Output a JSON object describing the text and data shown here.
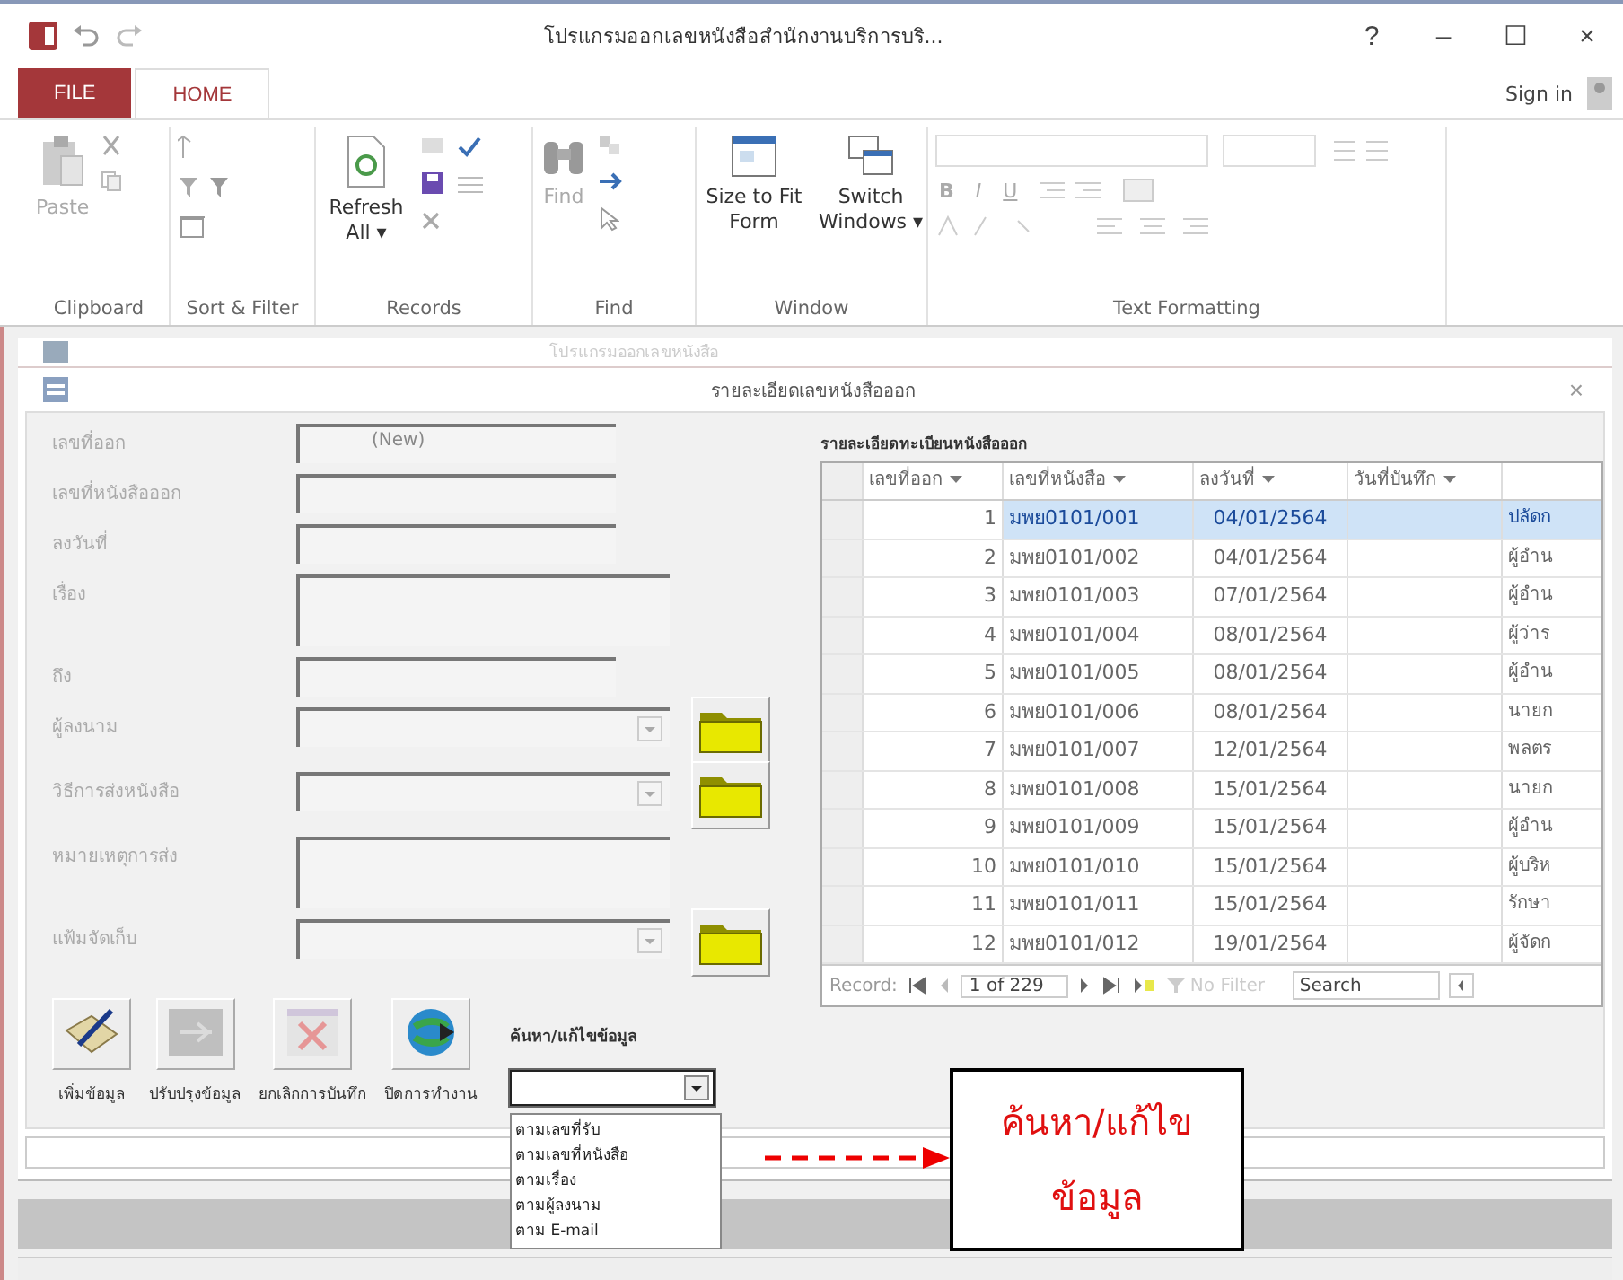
{
  "window": {
    "title": "โปรแกรมออกเลขหนังสือสำนักงานบริการบริ...",
    "help": "?",
    "minimize": "–",
    "maximize": "☐",
    "close": "×"
  },
  "ribbon": {
    "tabs": [
      {
        "label": "FILE",
        "kind": "file",
        "selected": false
      },
      {
        "label": "HOME",
        "kind": "tab",
        "selected": true
      }
    ],
    "sign_in": "Sign in",
    "groups": [
      {
        "label": "Clipboard",
        "buttons": [
          "Paste"
        ]
      },
      {
        "label": "Sort & Filter"
      },
      {
        "label": "Records",
        "buttons": [
          "Refresh All ▾"
        ]
      },
      {
        "label": "Find",
        "buttons": [
          "Find"
        ]
      },
      {
        "label": "Window",
        "buttons": [
          "Size to Fit Form",
          "Switch Windows ▾"
        ]
      },
      {
        "label": "Text Formatting",
        "buttons": [
          "B",
          "I",
          "U"
        ]
      }
    ]
  },
  "background_window": {
    "title": "โปรแกรมออกเลขหนังสือ"
  },
  "form": {
    "title": "รายละเอียดเลขหนังสือออก",
    "close": "×",
    "fields": [
      {
        "label": "เลขที่ออก",
        "kind": "text",
        "value": "(New)"
      },
      {
        "label": "เลขที่หนังสือออก",
        "kind": "text"
      },
      {
        "label": "ลงวันที่",
        "kind": "text"
      },
      {
        "label": "เรื่อง",
        "kind": "memo"
      },
      {
        "label": "ถึง",
        "kind": "text"
      },
      {
        "label": "ผู้ลงนาม",
        "kind": "combo"
      },
      {
        "label": "วิธีการส่งหนังสือ",
        "kind": "combo"
      },
      {
        "label": "หมายเหตุการส่ง",
        "kind": "memo"
      },
      {
        "label": "แฟ้มจัดเก็บ",
        "kind": "combo"
      }
    ],
    "buttons": [
      {
        "label": "เพิ่มข้อมูล",
        "kind": "add",
        "disabled": false
      },
      {
        "label": "ปรับปรุงข้อมูล",
        "kind": "update",
        "disabled": true
      },
      {
        "label": "ยกเลิกการบันทึก",
        "kind": "cancel",
        "disabled": true
      },
      {
        "label": "ปิดการทำงาน",
        "kind": "close",
        "disabled": false
      }
    ],
    "search": {
      "label": "ค้นหา/แก้ไขข้อมูล",
      "expanded": true,
      "options": [
        "ตามเลขที่รับ",
        "ตามเลขที่หนังสือ",
        "ตามเรื่อง",
        "ตามผู้ลงนาม",
        "ตาม E-mail"
      ]
    }
  },
  "table": {
    "title": "รายละเอียดทะเบียนหนังสือออก",
    "columns": [
      "เลขที่ออก",
      "เลขที่หนังสือ",
      "ลงวันที่",
      "วันที่บันทึก"
    ],
    "rows": [
      {
        "number": "1",
        "doc": "มพย0101/001",
        "date": "04/01/2564",
        "column_5": "ปลัดก",
        "selected": true
      },
      {
        "number": "2",
        "doc": "มพย0101/002",
        "date": "04/01/2564",
        "column_5": "ผู้อำน",
        "selected": false
      },
      {
        "number": "3",
        "doc": "มพย0101/003",
        "date": "07/01/2564",
        "column_5": "ผู้อำน",
        "selected": false
      },
      {
        "number": "4",
        "doc": "มพย0101/004",
        "date": "08/01/2564",
        "column_5": "ผู้ว่าร",
        "selected": false
      },
      {
        "number": "5",
        "doc": "มพย0101/005",
        "date": "08/01/2564",
        "column_5": "ผู้อำน",
        "selected": false
      },
      {
        "number": "6",
        "doc": "มพย0101/006",
        "date": "08/01/2564",
        "column_5": "นายก",
        "selected": false
      },
      {
        "number": "7",
        "doc": "มพย0101/007",
        "date": "12/01/2564",
        "column_5": "พลตร",
        "selected": false
      },
      {
        "number": "8",
        "doc": "มพย0101/008",
        "date": "15/01/2564",
        "column_5": "นายก",
        "selected": false
      },
      {
        "number": "9",
        "doc": "มพย0101/009",
        "date": "15/01/2564",
        "column_5": "ผู้อำน",
        "selected": false
      },
      {
        "number": "10",
        "doc": "มพย0101/010",
        "date": "15/01/2564",
        "column_5": "ผู้บริห",
        "selected": false
      },
      {
        "number": "11",
        "doc": "มพย0101/011",
        "date": "15/01/2564",
        "column_5": "รักษา",
        "selected": false
      },
      {
        "number": "12",
        "doc": "มพย0101/012",
        "date": "19/01/2564",
        "column_5": "ผู้จัดก",
        "selected": false
      }
    ],
    "navigation": {
      "label": "Record:",
      "position": "1 of 229",
      "filter": "No Filter",
      "search_placeholder": "Search"
    }
  },
  "callout": {
    "lines": [
      "ค้นหา/แก้ไข",
      "ข้อมูล"
    ]
  }
}
